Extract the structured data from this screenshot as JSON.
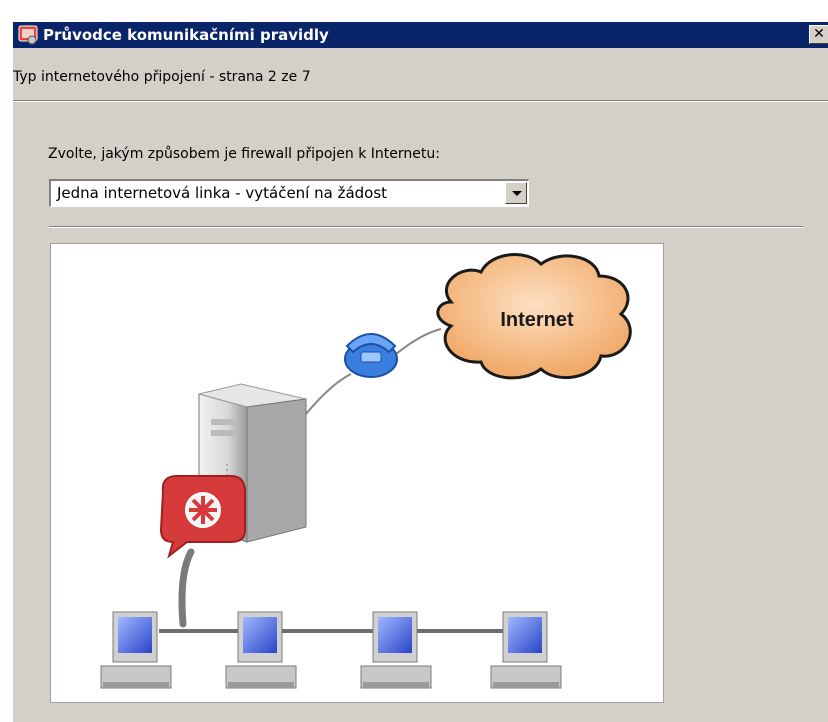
{
  "window": {
    "title": "Průvodce komunikačními pravidly",
    "close_glyph": "✕"
  },
  "page": {
    "header": "Typ internetového připojení - strana 2 ze 7",
    "prompt": "Zvolte, jakým způsobem je firewall připojen k Internetu:",
    "connection_select": {
      "value": "Jedna internetová linka - vytáčení na žádost"
    }
  },
  "diagram": {
    "cloud_label": "Internet",
    "icons": [
      "internet-cloud",
      "phone-modem",
      "server-tower",
      "firewall-badge",
      "workstation",
      "workstation",
      "workstation",
      "workstation"
    ]
  },
  "colors": {
    "title_bar": "#0a246a",
    "dialog_bg": "#d4d0c8",
    "cloud_fill": "#f5b577",
    "firewall_red": "#d63a3a",
    "phone_blue": "#3a7fe0"
  }
}
